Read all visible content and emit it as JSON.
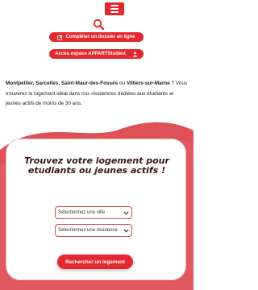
{
  "colors": {
    "accent": "#e4292e",
    "wave": "#dd5157",
    "title_text": "#3a1518"
  },
  "header": {
    "menu_icon": "hamburger-icon",
    "search_icon": "search-icon",
    "dossier_button": {
      "label": "Compléter un dossier en ligne",
      "icon": "edit-icon"
    },
    "appart_button": {
      "label": "Accès espace APPARTStudent",
      "icon": "login-icon"
    }
  },
  "intro": {
    "cities_1": "Montpellier, Sarcelles, Saint-Maur-des-Fossés",
    "or_text": " ou ",
    "cities_2": "Villiers-sur-Marne",
    "rest": " ? Vous trouverez le logement idéal dans nos résidences dédiées aux étudiants et jeunes actifs de moins de 30 ans."
  },
  "search_card": {
    "title": "Trouvez votre logement pour etudiants ou jeunes actifs !",
    "city_select": {
      "value": "Sélectionnez une ville"
    },
    "residence_select": {
      "value": "Sélectionnez une résidence"
    },
    "submit_label": "Rechercher un logement"
  }
}
